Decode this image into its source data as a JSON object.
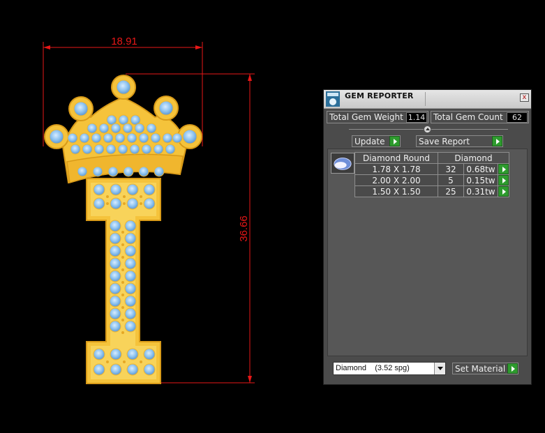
{
  "drawing": {
    "width_dimension": "18.91",
    "height_dimension": "36.66",
    "dimension_color": "#e81717",
    "metal_color": "#f5c33b",
    "stone_color": "#8fc4f0"
  },
  "panel": {
    "title": "GEM REPORTER",
    "close_glyph": "x",
    "total_weight_label": "Total Gem Weight",
    "total_weight_value": "1.14",
    "total_count_label": "Total Gem Count",
    "total_count_value": "62",
    "update_label": "Update",
    "save_report_label": "Save Report",
    "table": {
      "headers": [
        "Diamond Round",
        "Diamond"
      ],
      "rows": [
        {
          "size": "1.78 X 1.78",
          "count": "32",
          "weight": "0.68tw"
        },
        {
          "size": "2.00 X 2.00",
          "count": "5",
          "weight": "0.15tw"
        },
        {
          "size": "1.50 X 1.50",
          "count": "25",
          "weight": "0.31tw"
        }
      ]
    },
    "material_value": "Diamond    (3.52 spg)",
    "set_material_label": "Set Material",
    "accent_green": "#2e9b2e"
  }
}
